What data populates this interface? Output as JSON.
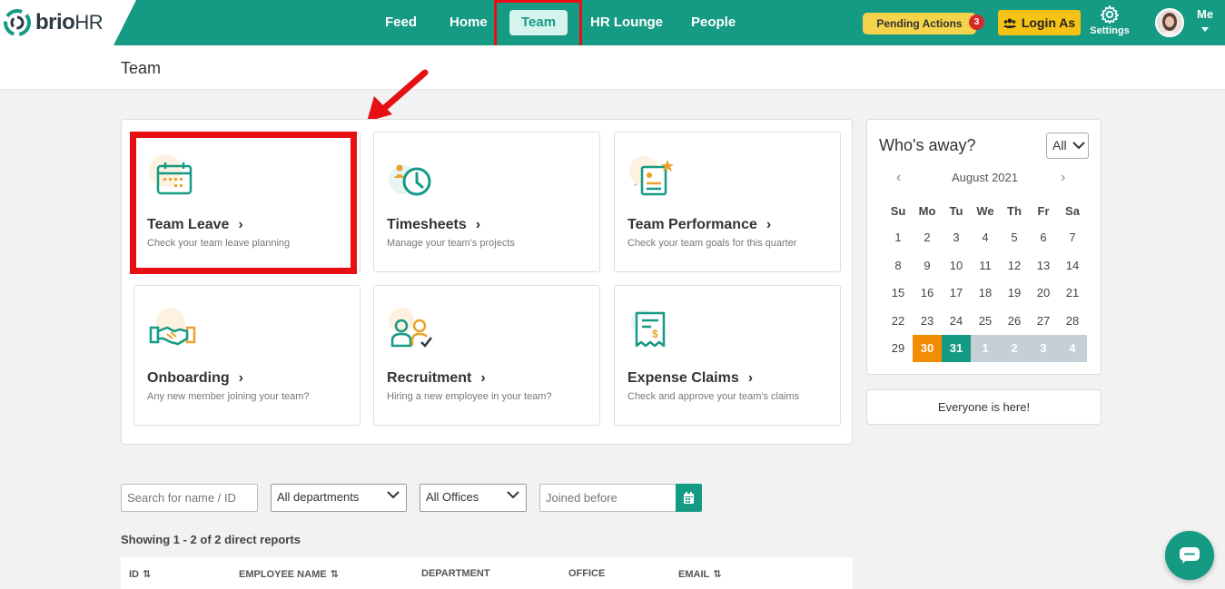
{
  "brand": {
    "name_main": "brio",
    "name_suffix": "HR"
  },
  "nav": {
    "items": [
      {
        "label": "Feed"
      },
      {
        "label": "Home"
      },
      {
        "label": "Team",
        "active": true
      },
      {
        "label": "HR Lounge"
      },
      {
        "label": "People"
      }
    ]
  },
  "header_right": {
    "pending_label": "Pending Actions",
    "pending_count": "3",
    "login_as_label": "Login As",
    "settings_label": "Settings",
    "me_label": "Me"
  },
  "page": {
    "title": "Team"
  },
  "tiles": [
    {
      "title": "Team Leave",
      "subtitle": "Check your team leave planning",
      "icon": "calendar-icon"
    },
    {
      "title": "Timesheets",
      "subtitle": "Manage your team's projects",
      "icon": "clock-icon"
    },
    {
      "title": "Team Performance",
      "subtitle": "Check your team goals for this quarter",
      "icon": "performance-icon"
    },
    {
      "title": "Onboarding",
      "subtitle": "Any new member joining your team?",
      "icon": "handshake-icon"
    },
    {
      "title": "Recruitment",
      "subtitle": "Hiring a new employee in your team?",
      "icon": "recruitment-icon"
    },
    {
      "title": "Expense Claims",
      "subtitle": "Check and approve your team's claims",
      "icon": "receipt-icon"
    }
  ],
  "calendar": {
    "title": "Who's away?",
    "filter_value": "All",
    "month_label": "August 2021",
    "weekdays": [
      "Su",
      "Mo",
      "Tu",
      "We",
      "Th",
      "Fr",
      "Sa"
    ],
    "weeks": [
      [
        "1",
        "2",
        "3",
        "4",
        "5",
        "6",
        "7"
      ],
      [
        "8",
        "9",
        "10",
        "11",
        "12",
        "13",
        "14"
      ],
      [
        "15",
        "16",
        "17",
        "18",
        "19",
        "20",
        "21"
      ],
      [
        "22",
        "23",
        "24",
        "25",
        "26",
        "27",
        "28"
      ],
      [
        "29",
        "30",
        "31",
        "1",
        "2",
        "3",
        "4"
      ]
    ],
    "status_message": "Everyone is here!"
  },
  "filters": {
    "search_placeholder": "Search for name / ID",
    "department_value": "All departments",
    "office_value": "All Offices",
    "joined_placeholder": "Joined before"
  },
  "results": {
    "summary": "Showing 1 - 2 of 2 direct reports"
  },
  "table": {
    "columns": [
      "ID",
      "EMPLOYEE NAME",
      "DEPARTMENT",
      "OFFICE",
      "EMAIL"
    ]
  },
  "colors": {
    "brand_green": "#159a84",
    "annotation_red": "#e50f14",
    "pending_yellow": "#f5d34a",
    "today_orange": "#f28c00"
  }
}
